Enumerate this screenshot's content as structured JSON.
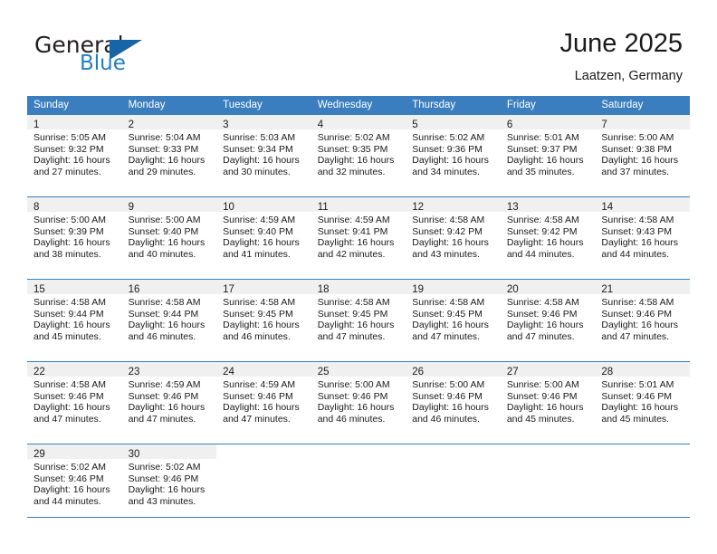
{
  "brand": {
    "name_part1": "General",
    "name_part2": "Blue",
    "flag_icon": "triangle-flag-icon",
    "accent_color": "#1565a8",
    "blue_text_color": "#1f7fc4"
  },
  "header": {
    "title": "June 2025",
    "subtitle": "Laatzen, Germany"
  },
  "calendar": {
    "header_bg": "#3a7ebf",
    "header_text_color": "#ffffff",
    "daynum_band_bg": "#f0f0f0",
    "weekday_headers": [
      "Sunday",
      "Monday",
      "Tuesday",
      "Wednesday",
      "Thursday",
      "Friday",
      "Saturday"
    ],
    "weeks": [
      [
        {
          "day": "1",
          "sunrise": "Sunrise: 5:05 AM",
          "sunset": "Sunset: 9:32 PM",
          "daylight_line1": "Daylight: 16 hours",
          "daylight_line2": "and 27 minutes."
        },
        {
          "day": "2",
          "sunrise": "Sunrise: 5:04 AM",
          "sunset": "Sunset: 9:33 PM",
          "daylight_line1": "Daylight: 16 hours",
          "daylight_line2": "and 29 minutes."
        },
        {
          "day": "3",
          "sunrise": "Sunrise: 5:03 AM",
          "sunset": "Sunset: 9:34 PM",
          "daylight_line1": "Daylight: 16 hours",
          "daylight_line2": "and 30 minutes."
        },
        {
          "day": "4",
          "sunrise": "Sunrise: 5:02 AM",
          "sunset": "Sunset: 9:35 PM",
          "daylight_line1": "Daylight: 16 hours",
          "daylight_line2": "and 32 minutes."
        },
        {
          "day": "5",
          "sunrise": "Sunrise: 5:02 AM",
          "sunset": "Sunset: 9:36 PM",
          "daylight_line1": "Daylight: 16 hours",
          "daylight_line2": "and 34 minutes."
        },
        {
          "day": "6",
          "sunrise": "Sunrise: 5:01 AM",
          "sunset": "Sunset: 9:37 PM",
          "daylight_line1": "Daylight: 16 hours",
          "daylight_line2": "and 35 minutes."
        },
        {
          "day": "7",
          "sunrise": "Sunrise: 5:00 AM",
          "sunset": "Sunset: 9:38 PM",
          "daylight_line1": "Daylight: 16 hours",
          "daylight_line2": "and 37 minutes."
        }
      ],
      [
        {
          "day": "8",
          "sunrise": "Sunrise: 5:00 AM",
          "sunset": "Sunset: 9:39 PM",
          "daylight_line1": "Daylight: 16 hours",
          "daylight_line2": "and 38 minutes."
        },
        {
          "day": "9",
          "sunrise": "Sunrise: 5:00 AM",
          "sunset": "Sunset: 9:40 PM",
          "daylight_line1": "Daylight: 16 hours",
          "daylight_line2": "and 40 minutes."
        },
        {
          "day": "10",
          "sunrise": "Sunrise: 4:59 AM",
          "sunset": "Sunset: 9:40 PM",
          "daylight_line1": "Daylight: 16 hours",
          "daylight_line2": "and 41 minutes."
        },
        {
          "day": "11",
          "sunrise": "Sunrise: 4:59 AM",
          "sunset": "Sunset: 9:41 PM",
          "daylight_line1": "Daylight: 16 hours",
          "daylight_line2": "and 42 minutes."
        },
        {
          "day": "12",
          "sunrise": "Sunrise: 4:58 AM",
          "sunset": "Sunset: 9:42 PM",
          "daylight_line1": "Daylight: 16 hours",
          "daylight_line2": "and 43 minutes."
        },
        {
          "day": "13",
          "sunrise": "Sunrise: 4:58 AM",
          "sunset": "Sunset: 9:42 PM",
          "daylight_line1": "Daylight: 16 hours",
          "daylight_line2": "and 44 minutes."
        },
        {
          "day": "14",
          "sunrise": "Sunrise: 4:58 AM",
          "sunset": "Sunset: 9:43 PM",
          "daylight_line1": "Daylight: 16 hours",
          "daylight_line2": "and 44 minutes."
        }
      ],
      [
        {
          "day": "15",
          "sunrise": "Sunrise: 4:58 AM",
          "sunset": "Sunset: 9:44 PM",
          "daylight_line1": "Daylight: 16 hours",
          "daylight_line2": "and 45 minutes."
        },
        {
          "day": "16",
          "sunrise": "Sunrise: 4:58 AM",
          "sunset": "Sunset: 9:44 PM",
          "daylight_line1": "Daylight: 16 hours",
          "daylight_line2": "and 46 minutes."
        },
        {
          "day": "17",
          "sunrise": "Sunrise: 4:58 AM",
          "sunset": "Sunset: 9:45 PM",
          "daylight_line1": "Daylight: 16 hours",
          "daylight_line2": "and 46 minutes."
        },
        {
          "day": "18",
          "sunrise": "Sunrise: 4:58 AM",
          "sunset": "Sunset: 9:45 PM",
          "daylight_line1": "Daylight: 16 hours",
          "daylight_line2": "and 47 minutes."
        },
        {
          "day": "19",
          "sunrise": "Sunrise: 4:58 AM",
          "sunset": "Sunset: 9:45 PM",
          "daylight_line1": "Daylight: 16 hours",
          "daylight_line2": "and 47 minutes."
        },
        {
          "day": "20",
          "sunrise": "Sunrise: 4:58 AM",
          "sunset": "Sunset: 9:46 PM",
          "daylight_line1": "Daylight: 16 hours",
          "daylight_line2": "and 47 minutes."
        },
        {
          "day": "21",
          "sunrise": "Sunrise: 4:58 AM",
          "sunset": "Sunset: 9:46 PM",
          "daylight_line1": "Daylight: 16 hours",
          "daylight_line2": "and 47 minutes."
        }
      ],
      [
        {
          "day": "22",
          "sunrise": "Sunrise: 4:58 AM",
          "sunset": "Sunset: 9:46 PM",
          "daylight_line1": "Daylight: 16 hours",
          "daylight_line2": "and 47 minutes."
        },
        {
          "day": "23",
          "sunrise": "Sunrise: 4:59 AM",
          "sunset": "Sunset: 9:46 PM",
          "daylight_line1": "Daylight: 16 hours",
          "daylight_line2": "and 47 minutes."
        },
        {
          "day": "24",
          "sunrise": "Sunrise: 4:59 AM",
          "sunset": "Sunset: 9:46 PM",
          "daylight_line1": "Daylight: 16 hours",
          "daylight_line2": "and 47 minutes."
        },
        {
          "day": "25",
          "sunrise": "Sunrise: 5:00 AM",
          "sunset": "Sunset: 9:46 PM",
          "daylight_line1": "Daylight: 16 hours",
          "daylight_line2": "and 46 minutes."
        },
        {
          "day": "26",
          "sunrise": "Sunrise: 5:00 AM",
          "sunset": "Sunset: 9:46 PM",
          "daylight_line1": "Daylight: 16 hours",
          "daylight_line2": "and 46 minutes."
        },
        {
          "day": "27",
          "sunrise": "Sunrise: 5:00 AM",
          "sunset": "Sunset: 9:46 PM",
          "daylight_line1": "Daylight: 16 hours",
          "daylight_line2": "and 45 minutes."
        },
        {
          "day": "28",
          "sunrise": "Sunrise: 5:01 AM",
          "sunset": "Sunset: 9:46 PM",
          "daylight_line1": "Daylight: 16 hours",
          "daylight_line2": "and 45 minutes."
        }
      ],
      [
        {
          "day": "29",
          "sunrise": "Sunrise: 5:02 AM",
          "sunset": "Sunset: 9:46 PM",
          "daylight_line1": "Daylight: 16 hours",
          "daylight_line2": "and 44 minutes."
        },
        {
          "day": "30",
          "sunrise": "Sunrise: 5:02 AM",
          "sunset": "Sunset: 9:46 PM",
          "daylight_line1": "Daylight: 16 hours",
          "daylight_line2": "and 43 minutes."
        },
        {
          "day": "",
          "sunrise": "",
          "sunset": "",
          "daylight_line1": "",
          "daylight_line2": ""
        },
        {
          "day": "",
          "sunrise": "",
          "sunset": "",
          "daylight_line1": "",
          "daylight_line2": ""
        },
        {
          "day": "",
          "sunrise": "",
          "sunset": "",
          "daylight_line1": "",
          "daylight_line2": ""
        },
        {
          "day": "",
          "sunrise": "",
          "sunset": "",
          "daylight_line1": "",
          "daylight_line2": ""
        },
        {
          "day": "",
          "sunrise": "",
          "sunset": "",
          "daylight_line1": "",
          "daylight_line2": ""
        }
      ]
    ]
  }
}
